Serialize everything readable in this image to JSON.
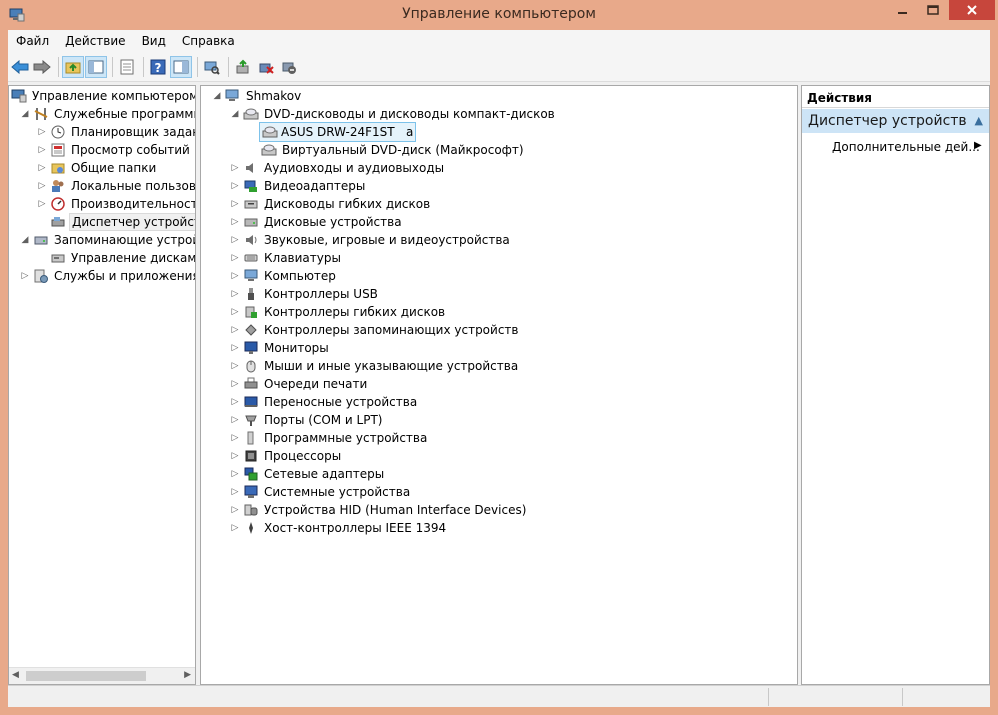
{
  "window": {
    "title": "Управление компьютером",
    "accent": "#e8a98a",
    "close_color": "#c7463c"
  },
  "menu": {
    "items": [
      "Файл",
      "Действие",
      "Вид",
      "Справка"
    ]
  },
  "toolbar": {
    "buttons": [
      "back-icon",
      "forward-icon",
      "up-folder-icon",
      "show-tree-icon",
      "export-icon",
      "help-icon",
      "properties-icon",
      "scan-hardware-icon",
      "update-driver-icon",
      "uninstall-device-icon",
      "disable-device-icon"
    ]
  },
  "left_tree": {
    "root": "Управление компьютером (л",
    "utilities": "Служебные программы",
    "task_scheduler": "Планировщик заданий",
    "event_viewer": "Просмотр событий",
    "shared_folders": "Общие папки",
    "local_users": "Локальные пользовате",
    "performance": "Производительность",
    "device_manager": "Диспетчер устройств",
    "storage": "Запоминающие устройст",
    "disk_management": "Управление дисками",
    "services": "Службы и приложения"
  },
  "device_tree": {
    "computer": "Shmakov",
    "dvd_category": "DVD-дисководы и дисководы компакт-дисков",
    "dvd_device_1": "ASUS DRW-24F1ST   a",
    "dvd_device_2": "Виртуальный DVD-диск (Майкрософт)",
    "categories": [
      "Аудиовходы и аудиовыходы",
      "Видеоадаптеры",
      "Дисководы гибких дисков",
      "Дисковые устройства",
      "Звуковые, игровые и видеоустройства",
      "Клавиатуры",
      "Компьютер",
      "Контроллеры USB",
      "Контроллеры гибких дисков",
      "Контроллеры запоминающих устройств",
      "Мониторы",
      "Мыши и иные указывающие устройства",
      "Очереди печати",
      "Переносные устройства",
      "Порты (COM и LPT)",
      "Программные устройства",
      "Процессоры",
      "Сетевые адаптеры",
      "Системные устройства",
      "Устройства HID (Human Interface Devices)",
      "Хост-контроллеры IEEE 1394"
    ]
  },
  "actions": {
    "header": "Действия",
    "section": "Диспетчер устройств",
    "more": "Дополнительные дей..."
  }
}
